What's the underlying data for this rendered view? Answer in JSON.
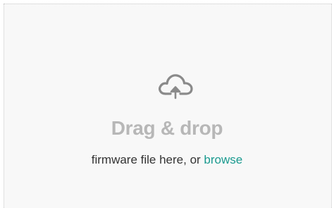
{
  "dropzone": {
    "icon": "cloud-upload-icon",
    "title": "Drag & drop",
    "hint_text": "firmware file here, or ",
    "browse_label": "browse"
  },
  "colors": {
    "title": "#b7b7b7",
    "hint": "#333333",
    "browse_link": "#1a9a8f",
    "icon": "#8a8a8a",
    "background": "#f8f8f8",
    "border": "#c8c8c8"
  }
}
